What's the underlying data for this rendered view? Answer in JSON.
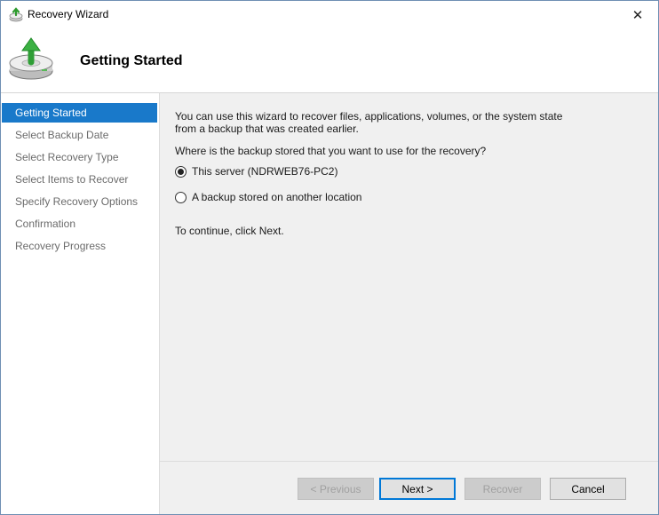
{
  "window": {
    "title": "Recovery Wizard",
    "close_glyph": "✕",
    "app_icon": "backup-recovery-icon"
  },
  "header": {
    "title": "Getting Started",
    "icon": "disk-recovery-arrow-icon"
  },
  "sidebar": {
    "items": [
      {
        "label": "Getting Started",
        "active": true
      },
      {
        "label": "Select Backup Date",
        "active": false
      },
      {
        "label": "Select Recovery Type",
        "active": false
      },
      {
        "label": "Select Items to Recover",
        "active": false
      },
      {
        "label": "Specify Recovery Options",
        "active": false
      },
      {
        "label": "Confirmation",
        "active": false
      },
      {
        "label": "Recovery Progress",
        "active": false
      }
    ]
  },
  "main": {
    "intro_line1": "You can use this wizard to recover files, applications, volumes, or the system state",
    "intro_line2": "from a backup that was created earlier.",
    "question": "Where is the backup stored that you want to use for the recovery?",
    "options": [
      {
        "label": "This server (NDRWEB76-PC2)",
        "selected": true
      },
      {
        "label": "A backup stored on another location",
        "selected": false
      }
    ],
    "continue_text": "To continue, click Next."
  },
  "footer": {
    "previous_label": "< Previous",
    "next_label": "Next >",
    "recover_label": "Recover",
    "cancel_label": "Cancel"
  },
  "colors": {
    "accent": "#1979ca",
    "content_bg": "#f0f0f0",
    "nav_text": "#6b6b6b"
  }
}
